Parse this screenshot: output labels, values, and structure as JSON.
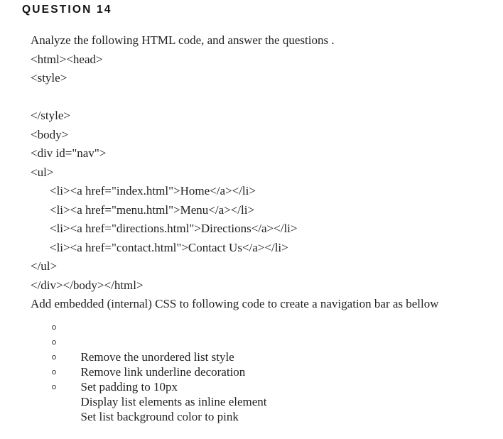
{
  "question": {
    "title": "QUESTION 14",
    "intro": "Analyze the following HTML code, and answer the questions .",
    "code_lines": [
      {
        "text": "<html><head>",
        "indent": false
      },
      {
        "text": "<style>",
        "indent": false
      },
      {
        "text": "",
        "indent": false
      },
      {
        "text": "</style>",
        "indent": false
      },
      {
        "text": "<body>",
        "indent": false
      },
      {
        "text": "<div id=\"nav\">",
        "indent": false
      },
      {
        "text": "<ul>",
        "indent": false
      },
      {
        "text": "<li><a href=\"index.html\">Home</a></li>",
        "indent": true
      },
      {
        "text": "<li><a href=\"menu.html\">Menu</a></li>",
        "indent": true
      },
      {
        "text": "<li><a href=\"directions.html\">Directions</a></li>",
        "indent": true
      },
      {
        "text": "<li><a href=\"contact.html\">Contact Us</a></li>",
        "indent": true
      },
      {
        "text": "</ul>",
        "indent": false
      },
      {
        "text": "</div></body></html>",
        "indent": false
      }
    ],
    "instruction": "Add embedded (internal) CSS to following code to create a navigation bar as bellow",
    "tasks": [
      "Remove the unordered list style",
      "Remove link underline decoration",
      "Set padding to 10px",
      "Display list elements as inline element",
      "Set list background color to pink"
    ]
  }
}
